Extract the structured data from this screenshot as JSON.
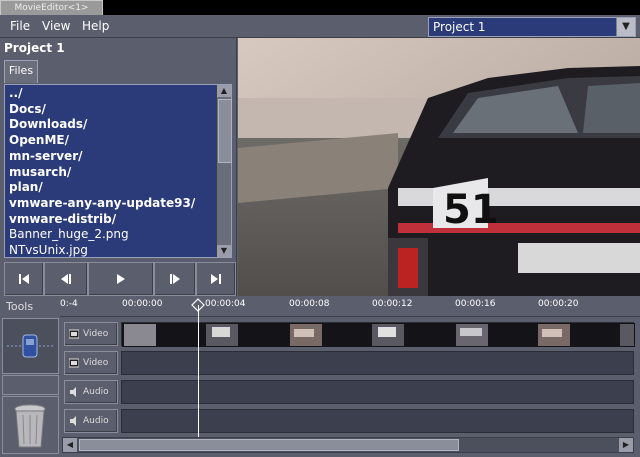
{
  "window": {
    "title": "MovieEditor<1>"
  },
  "menu": {
    "file": "File",
    "view": "View",
    "help": "Help"
  },
  "project_select": {
    "value": "Project 1",
    "arrow": "▼"
  },
  "project": {
    "title": "Project 1"
  },
  "files_tab": {
    "label": "Files"
  },
  "files": [
    {
      "name": "../",
      "type": "dir"
    },
    {
      "name": "Docs/",
      "type": "dir"
    },
    {
      "name": "Downloads/",
      "type": "dir"
    },
    {
      "name": "OpenME/",
      "type": "dir"
    },
    {
      "name": "mn-server/",
      "type": "dir"
    },
    {
      "name": "musarch/",
      "type": "dir"
    },
    {
      "name": "plan/",
      "type": "dir"
    },
    {
      "name": "vmware-any-any-update93/",
      "type": "dir"
    },
    {
      "name": "vmware-distrib/",
      "type": "dir"
    },
    {
      "name": "Banner_huge_2.png",
      "type": "file"
    },
    {
      "name": "NTvsUnix.jpg",
      "type": "file"
    }
  ],
  "transport": {
    "first": "⏮",
    "prev": "◀",
    "play": "▶",
    "next": "▶",
    "last": "⏭"
  },
  "timeline": {
    "tools_label": "Tools",
    "ticks": [
      "0:-4",
      "00:00:00",
      "00:00:04",
      "00:00:08",
      "00:00:12",
      "00:00:16",
      "00:00:20"
    ],
    "tracks": [
      {
        "label": "Video",
        "kind": "video"
      },
      {
        "label": "Video",
        "kind": "video"
      },
      {
        "label": "Audio",
        "kind": "audio"
      },
      {
        "label": "Audio",
        "kind": "audio"
      }
    ],
    "hscroll": {
      "left": "◀",
      "right": "▶"
    }
  },
  "colors": {
    "list_bg": "#2b3a78",
    "panel": "#5b5e6c",
    "track": "#3c3f4d"
  }
}
